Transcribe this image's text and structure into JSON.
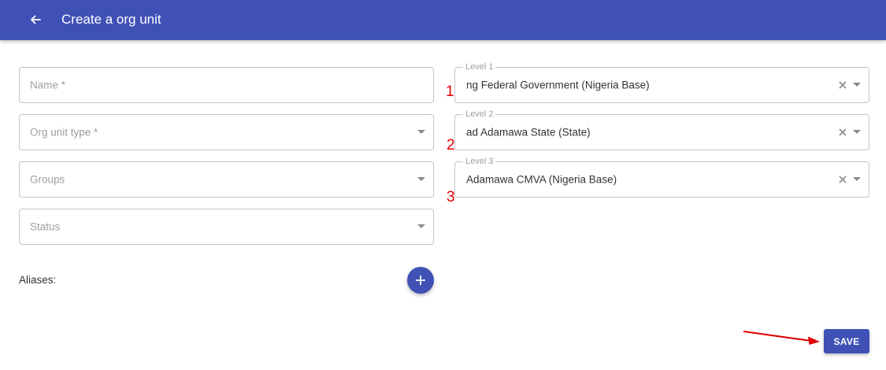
{
  "header": {
    "title": "Create a org unit",
    "back_icon": "arrow-left-icon"
  },
  "form": {
    "name": {
      "placeholder": "Name *",
      "value": ""
    },
    "org_unit_type": {
      "placeholder": "Org unit type *",
      "value": ""
    },
    "groups": {
      "placeholder": "Groups",
      "value": ""
    },
    "status": {
      "placeholder": "Status",
      "value": ""
    },
    "aliases_label": "Aliases:",
    "add_alias_icon": "plus-icon"
  },
  "levels": [
    {
      "label": "Level 1",
      "value": "ng Federal Government (Nigeria Base)",
      "marker": "1"
    },
    {
      "label": "Level 2",
      "value": "ad Adamawa State (State)",
      "marker": "2"
    },
    {
      "label": "Level 3",
      "value": "Adamawa CMVA (Nigeria Base)",
      "marker": "3"
    }
  ],
  "actions": {
    "save_label": "SAVE"
  },
  "colors": {
    "primary": "#3f51b5",
    "annotation": "#e00000",
    "border": "#c4c4c4",
    "placeholder": "#9e9e9e"
  }
}
